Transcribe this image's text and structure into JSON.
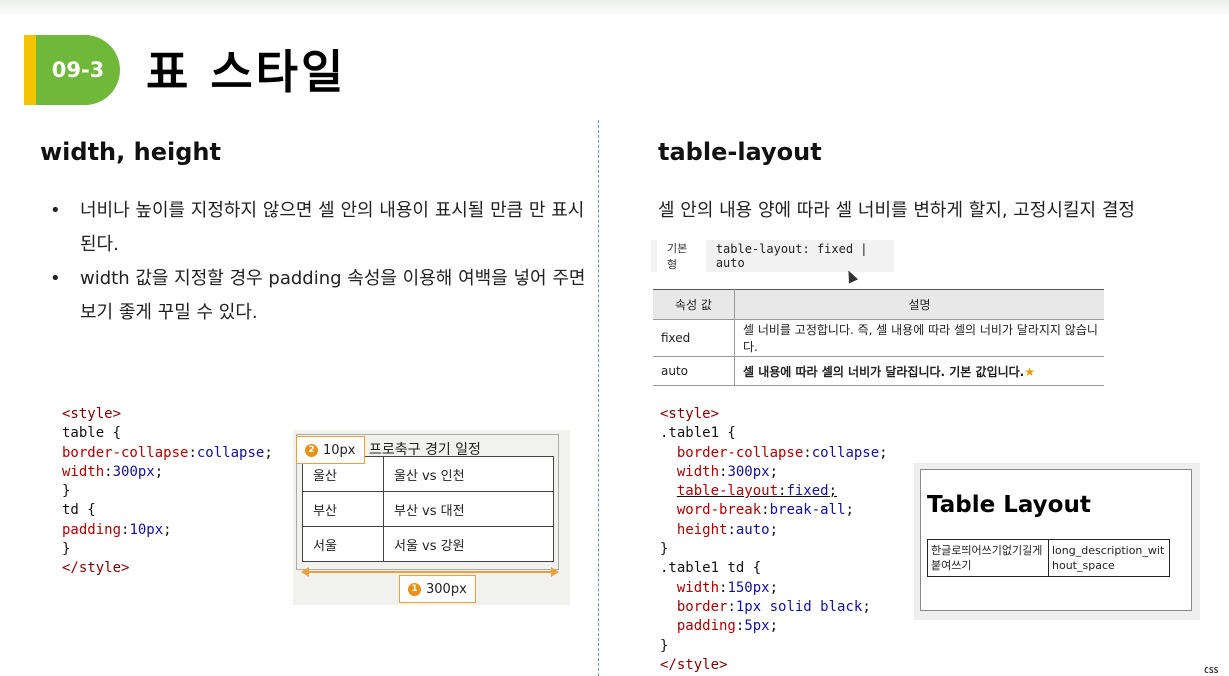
{
  "header": {
    "badge": "09-3",
    "title": "표 스타일"
  },
  "left": {
    "heading": "width, height",
    "bullets": [
      "너비나 높이를 지정하지 않으면 셀 안의 내용이 표시될 만큼 만 표시된다.",
      "width 값을 지정할 경우 padding 속성을 이용해 여백을 넣어 주면 보기 좋게 꾸밀 수 있다."
    ],
    "bullet_mark": "•",
    "code": {
      "l1": "<style>",
      "l2_sel": "table {",
      "l3_prop": "border-collapse",
      "l3_val": "collapse",
      "l4_prop": "width",
      "l4_val": "300px",
      "l5": "}",
      "l6_sel": "td {",
      "l7_prop": "padding",
      "l7_val": "10px",
      "l8": "}",
      "l9": "</style>"
    },
    "figure": {
      "caption": "프로축구 경기 일정",
      "rows": [
        [
          "울산",
          "울산 vs 인천"
        ],
        [
          "부산",
          "부산 vs 대전"
        ],
        [
          "서울",
          "서울 vs 강원"
        ]
      ],
      "callout_padding": {
        "num": "2",
        "text": "10px"
      },
      "callout_width": {
        "num": "1",
        "text": "300px"
      }
    }
  },
  "right": {
    "heading": "table-layout",
    "description": "셀 안의 내용 양에 따라 셀 너비를 변하게 할지, 고정시킬지 결정",
    "syntax": {
      "tag": "기본형",
      "code": "table-layout: fixed | auto"
    },
    "prop_table": {
      "headers": [
        "속성 값",
        "설명"
      ],
      "rows": [
        [
          "fixed",
          "셀 너비를 고정합니다. 즉, 셀 내용에 따라 셀의 너비가 달라지지 않습니다."
        ],
        [
          "auto",
          "셀 내용에 따라 셀의 너비가 달라집니다. 기본 값입니다."
        ]
      ],
      "star": "★"
    },
    "code": {
      "l1": "<style>",
      "l2_sel": ".table1 {",
      "l3_prop": "border-collapse",
      "l3_val": "collapse",
      "l4_prop": "width",
      "l4_val": "300px",
      "l5_prop": "table-layout",
      "l5_val": "fixed",
      "l6_prop": "word-break",
      "l6_val": "break-all",
      "l7_prop": "height",
      "l7_val": "auto",
      "l8": "}",
      "l9_sel": ".table1 td {",
      "l10_prop": "width",
      "l10_val": "150px",
      "l11_prop": "border",
      "l11_val": "1px solid black",
      "l12_prop": "padding",
      "l12_val": "5px",
      "l13": "}",
      "l14": "</style>"
    },
    "figure": {
      "heading": "Table Layout",
      "cell1": "한글로띄어쓰기없기길게붙여쓰기",
      "cell2": "long_description_without_space"
    }
  },
  "corner_label": "CSS"
}
